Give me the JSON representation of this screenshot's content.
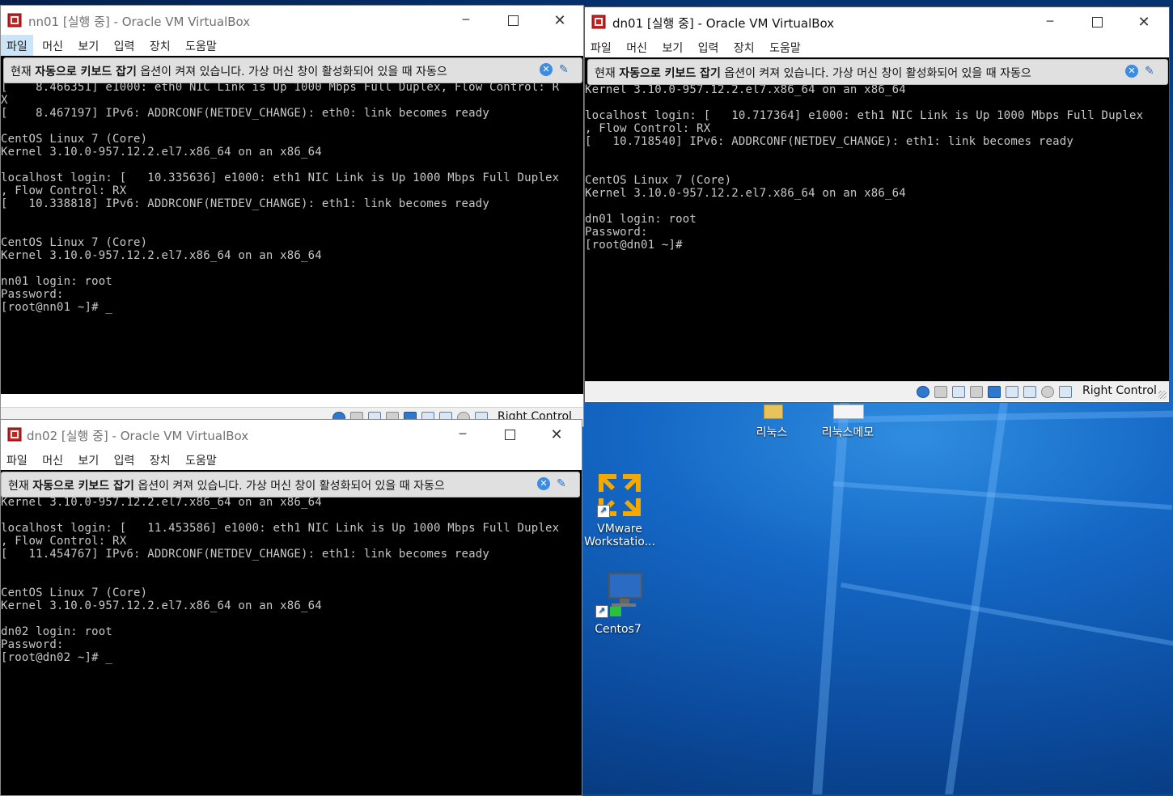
{
  "desktop": {
    "icons": [
      {
        "label": "리눅스",
        "icon": "folder-icon"
      },
      {
        "label": "리눅스메모",
        "icon": "document-icon"
      },
      {
        "label": "VMware Workstatio...",
        "icon": "vmware-icon"
      },
      {
        "label": "Centos7",
        "icon": "computer-icon"
      }
    ]
  },
  "menu": [
    "파일",
    "머신",
    "보기",
    "입력",
    "장치",
    "도움말"
  ],
  "notice": {
    "prefix": "현재 ",
    "bold": "자동으로 키보드 잡기",
    "suffix": " 옵션이 켜져 있습니다. 가상 머신 창이 활성화되어 있을 때 자동으"
  },
  "host_key": "Right Control",
  "windows": {
    "nn01": {
      "title": "nn01 [실행 중] - Oracle VM VirtualBox",
      "console": "[    8.466351] e1000: eth0 NIC Link is Up 1000 Mbps Full Duplex, Flow Control: R\nX\n[    8.467197] IPv6: ADDRCONF(NETDEV_CHANGE): eth0: link becomes ready\n\nCentOS Linux 7 (Core)\nKernel 3.10.0-957.12.2.el7.x86_64 on an x86_64\n\nlocalhost login: [   10.335636] e1000: eth1 NIC Link is Up 1000 Mbps Full Duplex\n, Flow Control: RX\n[   10.338818] IPv6: ADDRCONF(NETDEV_CHANGE): eth1: link becomes ready\n\n\nCentOS Linux 7 (Core)\nKernel 3.10.0-957.12.2.el7.x86_64 on an x86_64\n\nnn01 login: root\nPassword:\n[root@nn01 ~]# _"
    },
    "dn01": {
      "title": "dn01 [실행 중] - Oracle VM VirtualBox",
      "console": "Kernel 3.10.0-957.12.2.el7.x86_64 on an x86_64\n\nlocalhost login: [   10.717364] e1000: eth1 NIC Link is Up 1000 Mbps Full Duplex\n, Flow Control: RX\n[   10.718540] IPv6: ADDRCONF(NETDEV_CHANGE): eth1: link becomes ready\n\n\nCentOS Linux 7 (Core)\nKernel 3.10.0-957.12.2.el7.x86_64 on an x86_64\n\ndn01 login: root\nPassword:\n[root@dn01 ~]#"
    },
    "dn02": {
      "title": "dn02 [실행 중] - Oracle VM VirtualBox",
      "console": "Kernel 3.10.0-957.12.2.el7.x86_64 on an x86_64\n\nlocalhost login: [   11.453586] e1000: eth1 NIC Link is Up 1000 Mbps Full Duplex\n, Flow Control: RX\n[   11.454767] IPv6: ADDRCONF(NETDEV_CHANGE): eth1: link becomes ready\n\n\nCentOS Linux 7 (Core)\nKernel 3.10.0-957.12.2.el7.x86_64 on an x86_64\n\ndn02 login: root\nPassword:\n[root@dn02 ~]# _"
    }
  }
}
